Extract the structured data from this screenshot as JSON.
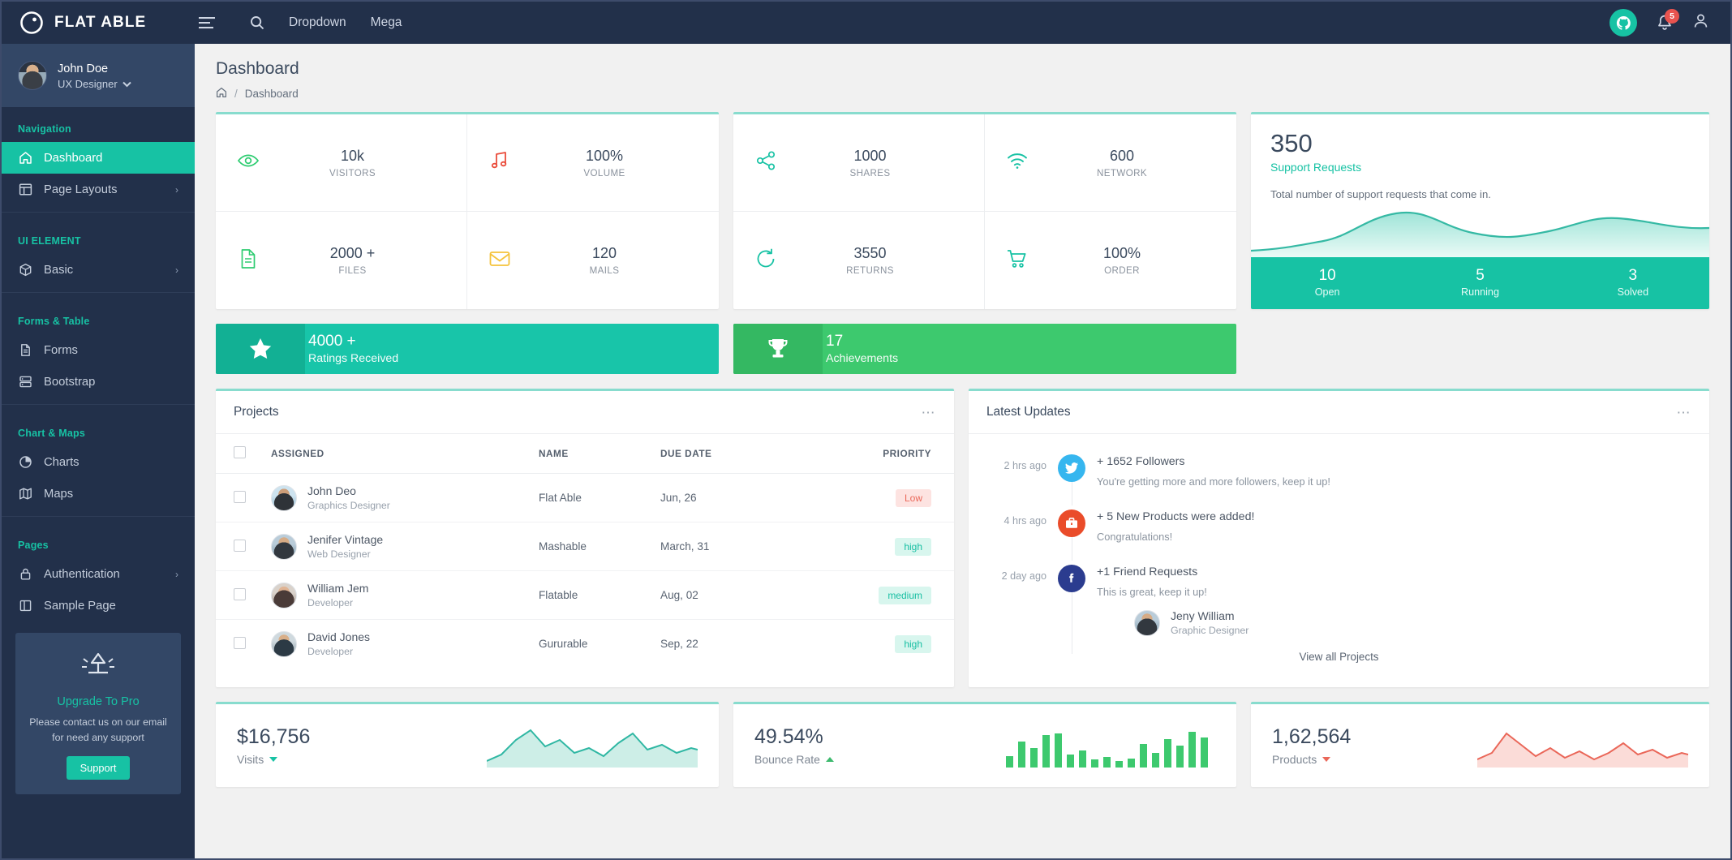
{
  "topbar": {
    "brand": "FLAT ABLE",
    "menu": [
      {
        "label": "Dropdown"
      },
      {
        "label": "Mega"
      }
    ],
    "notification_count": "5"
  },
  "sidebar": {
    "user": {
      "name": "John Doe",
      "role": "UX Designer"
    },
    "sections": [
      {
        "caption": "Navigation",
        "items": [
          {
            "label": "Dashboard",
            "icon": "home-icon",
            "active": true,
            "arrow": false
          },
          {
            "label": "Page Layouts",
            "icon": "layout-icon",
            "active": false,
            "arrow": true
          }
        ]
      },
      {
        "caption": "UI ELEMENT",
        "items": [
          {
            "label": "Basic",
            "icon": "box-icon",
            "active": false,
            "arrow": true
          }
        ]
      },
      {
        "caption": "Forms & Table",
        "items": [
          {
            "label": "Forms",
            "icon": "file-icon",
            "active": false,
            "arrow": false
          },
          {
            "label": "Bootstrap",
            "icon": "table-icon",
            "active": false,
            "arrow": false
          }
        ]
      },
      {
        "caption": "Chart & Maps",
        "items": [
          {
            "label": "Charts",
            "icon": "pie-chart-icon",
            "active": false,
            "arrow": false
          },
          {
            "label": "Maps",
            "icon": "map-icon",
            "active": false,
            "arrow": false
          }
        ]
      },
      {
        "caption": "Pages",
        "items": [
          {
            "label": "Authentication",
            "icon": "lock-icon",
            "active": false,
            "arrow": true
          },
          {
            "label": "Sample Page",
            "icon": "page-icon",
            "active": false,
            "arrow": false
          }
        ]
      }
    ],
    "upgrade": {
      "title": "Upgrade To Pro",
      "description": "Please contact us on our email for need any support",
      "button": "Support"
    }
  },
  "page": {
    "title": "Dashboard",
    "breadcrumb": [
      "Dashboard"
    ]
  },
  "stats_left": [
    {
      "value": "10k",
      "label": "VISITORS",
      "icon": "eye-icon",
      "color": "#2ecc71"
    },
    {
      "value": "100%",
      "label": "VOLUME",
      "icon": "music-icon",
      "color": "#ea4c3b"
    },
    {
      "value": "2000 +",
      "label": "FILES",
      "icon": "file-icon",
      "color": "#2ecc71"
    },
    {
      "value": "120",
      "label": "MAILS",
      "icon": "mail-icon",
      "color": "#f5c33b"
    }
  ],
  "stats_mid": [
    {
      "value": "1000",
      "label": "SHARES",
      "icon": "share-icon",
      "color": "#17c2a4"
    },
    {
      "value": "600",
      "label": "NETWORK",
      "icon": "wifi-icon",
      "color": "#17c2a4"
    },
    {
      "value": "3550",
      "label": "RETURNS",
      "icon": "refresh-icon",
      "color": "#17c2a4"
    },
    {
      "value": "100%",
      "label": "ORDER",
      "icon": "cart-icon",
      "color": "#17c2a4"
    }
  ],
  "banners": [
    {
      "value": "4000 +",
      "label": "Ratings Received",
      "icon": "star-icon",
      "bg": "#18c5a9",
      "icon_bg": "#12b094"
    },
    {
      "value": "17",
      "label": "Achievements",
      "icon": "trophy-icon",
      "bg": "#3dc96e",
      "icon_bg": "#34b862"
    }
  ],
  "support": {
    "number": "350",
    "subtitle": "Support Requests",
    "description": "Total number of support requests that come in.",
    "stats": [
      {
        "num": "10",
        "label": "Open"
      },
      {
        "num": "5",
        "label": "Running"
      },
      {
        "num": "3",
        "label": "Solved"
      }
    ]
  },
  "projects": {
    "title": "Projects",
    "columns": [
      "ASSIGNED",
      "NAME",
      "DUE DATE",
      "PRIORITY"
    ],
    "rows": [
      {
        "name": "John Deo",
        "role": "Graphics Designer",
        "project": "Flat Able",
        "due": "Jun, 26",
        "priority": "Low",
        "priority_class": "badge-low"
      },
      {
        "name": "Jenifer Vintage",
        "role": "Web Designer",
        "project": "Mashable",
        "due": "March, 31",
        "priority": "high",
        "priority_class": "badge-high"
      },
      {
        "name": "William Jem",
        "role": "Developer",
        "project": "Flatable",
        "due": "Aug, 02",
        "priority": "medium",
        "priority_class": "badge-medium"
      },
      {
        "name": "David Jones",
        "role": "Developer",
        "project": "Gururable",
        "due": "Sep, 22",
        "priority": "high",
        "priority_class": "badge-high"
      }
    ]
  },
  "updates": {
    "title": "Latest Updates",
    "items": [
      {
        "time": "2 hrs ago",
        "icon": "twitter-icon",
        "bg": "#36b6ef",
        "title": "+ 1652 Followers",
        "sub": "You're getting more and more followers, keep it up!"
      },
      {
        "time": "4 hrs ago",
        "icon": "briefcase-icon",
        "bg": "#ea4c2a",
        "title": "+ 5 New Products were added!",
        "sub": "Congratulations!"
      },
      {
        "time": "2 day ago",
        "icon": "facebook-icon",
        "bg": "#2b3c8f",
        "title": "+1 Friend Requests",
        "sub": "This is great, keep it up!"
      }
    ],
    "person": {
      "name": "Jeny William",
      "role": "Graphic Designer"
    },
    "view_all": "View all Projects"
  },
  "bottom_stats": [
    {
      "value": "$16,756",
      "label": "Visits",
      "trend": "down",
      "chart": "area-teal"
    },
    {
      "value": "49.54%",
      "label": "Bounce Rate",
      "trend": "up",
      "chart": "bars-green"
    },
    {
      "value": "1,62,564",
      "label": "Products",
      "trend": "down-red",
      "chart": "area-red"
    }
  ],
  "chart_data": {
    "type": "area",
    "title": "Support Requests",
    "series": [
      {
        "name": "Support Requests",
        "values": [
          12,
          14,
          20,
          38,
          62,
          70,
          66,
          52,
          40,
          36,
          44,
          58,
          60,
          50,
          44,
          48,
          56,
          52
        ]
      }
    ],
    "x": [
      0,
      1,
      2,
      3,
      4,
      5,
      6,
      7,
      8,
      9,
      10,
      11,
      12,
      13,
      14,
      15,
      16,
      17
    ],
    "sparklines": [
      {
        "name": "Visits",
        "type": "area",
        "values": [
          8,
          12,
          30,
          44,
          28,
          34,
          20,
          26,
          18,
          30,
          40,
          24,
          30,
          22,
          26
        ]
      },
      {
        "name": "Bounce Rate",
        "type": "bar",
        "values": [
          14,
          30,
          22,
          38,
          40,
          16,
          20,
          10,
          13,
          8,
          11,
          28,
          18,
          34,
          26,
          42,
          36
        ]
      },
      {
        "name": "Products",
        "type": "area",
        "values": [
          10,
          18,
          42,
          30,
          16,
          24,
          14,
          20,
          12,
          18,
          26,
          16,
          22,
          14,
          18
        ]
      }
    ],
    "grid": false,
    "legend": "none"
  }
}
